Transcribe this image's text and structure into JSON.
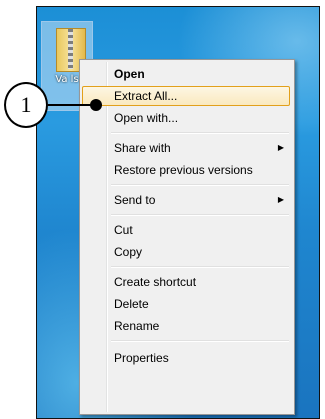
{
  "desktop_icon": {
    "label": "Va ls"
  },
  "context_menu": {
    "items": [
      {
        "label": "Open",
        "bold": true
      },
      {
        "label": "Extract All...",
        "highlighted": true
      },
      {
        "label": "Open with..."
      },
      {
        "label": "Share with",
        "submenu": true
      },
      {
        "label": "Restore previous versions"
      },
      {
        "label": "Send to",
        "submenu": true
      },
      {
        "label": "Cut"
      },
      {
        "label": "Copy"
      },
      {
        "label": "Create shortcut"
      },
      {
        "label": "Delete"
      },
      {
        "label": "Rename"
      },
      {
        "label": "Properties"
      }
    ]
  },
  "callout": {
    "number": "1"
  },
  "colors": {
    "highlight_border": "#e2a01b",
    "desktop_blue": "#1f86cf"
  }
}
